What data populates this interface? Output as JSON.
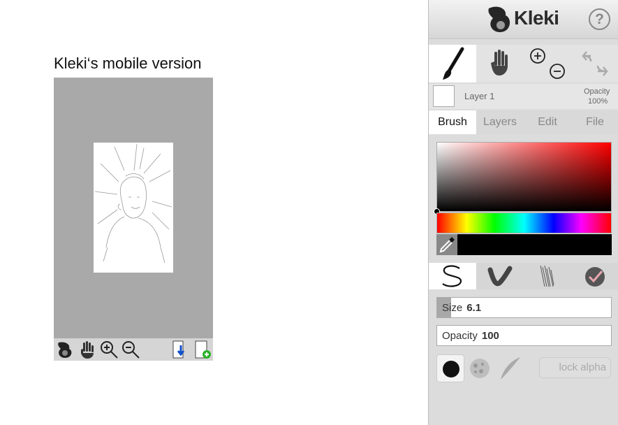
{
  "demo": {
    "title": "Kleki‘s mobile version",
    "toolbar_icons": [
      "kleki-logo-icon",
      "hand-icon",
      "zoom-in-icon",
      "zoom-out-icon",
      "save-icon",
      "new-image-icon"
    ]
  },
  "header": {
    "app_name": "Kleki",
    "help_label": "?"
  },
  "tools": [
    "brush-tool",
    "hand-tool",
    "zoom-tool",
    "undo-redo"
  ],
  "layer": {
    "name": "Layer 1",
    "opacity_label": "Opacity",
    "opacity_value": "100%"
  },
  "tabs": [
    {
      "label": "Brush",
      "active": true
    },
    {
      "label": "Layers",
      "active": false
    },
    {
      "label": "Edit",
      "active": false
    },
    {
      "label": "File",
      "active": false
    }
  ],
  "colors": {
    "hue": "#ff0000",
    "selected": "#000000"
  },
  "brushes": [
    "pen-brush",
    "blend-brush",
    "sketchy-brush",
    "smooth-brush"
  ],
  "size": {
    "label": "Size",
    "value": "6.1",
    "fraction": 0.08
  },
  "opacity": {
    "label": "Opacity",
    "value": "100",
    "fraction": 1.0
  },
  "lock_alpha": "lock alpha"
}
